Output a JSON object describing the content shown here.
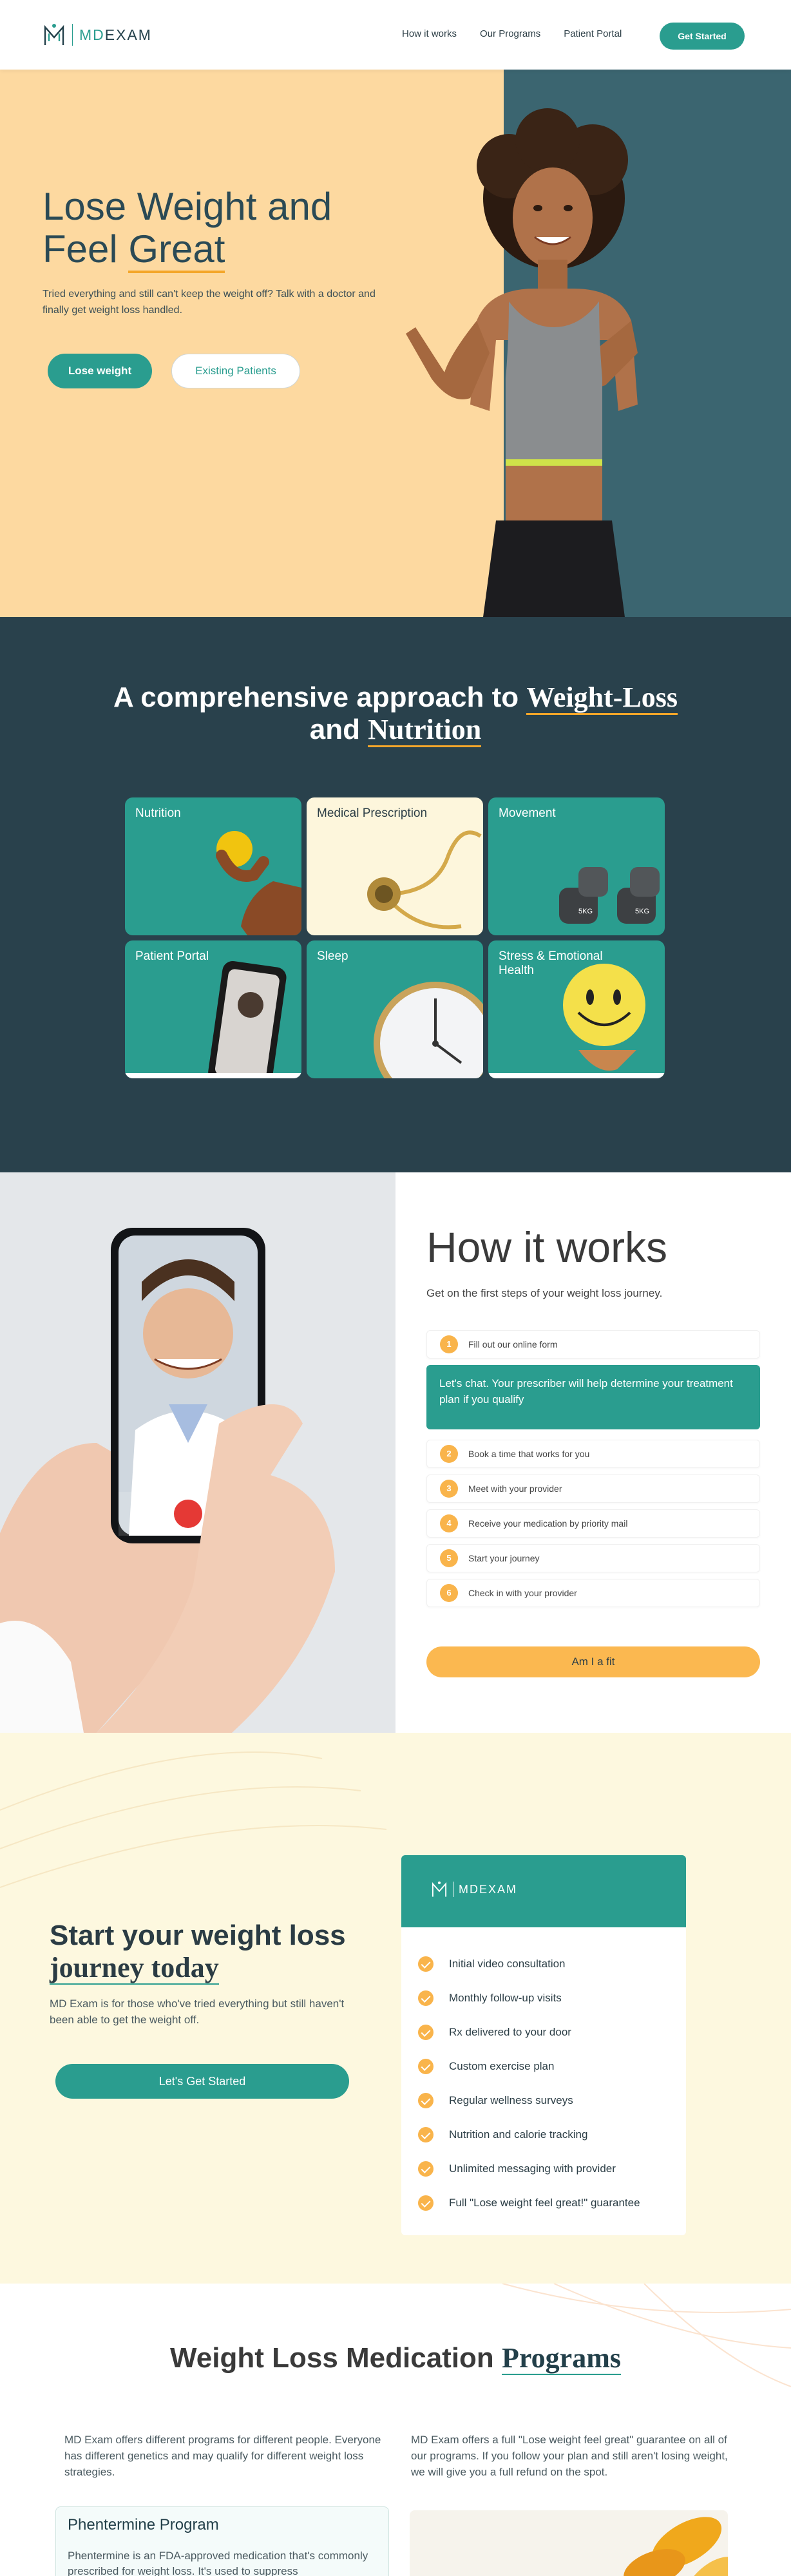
{
  "nav": {
    "logo_m": "MD",
    "logo_rest": "EXAM",
    "links": [
      "How it works",
      "Our Programs",
      "Patient Portal"
    ],
    "cta": "Get Started"
  },
  "hero": {
    "title_line1": "Lose Weight and",
    "title_line2a": "Feel ",
    "title_line2b": "Great",
    "subtitle": "Tried everything and still can't keep the weight off? Talk with a doctor and finally get weight loss handled.",
    "primary_button": "Lose weight",
    "secondary_button": "Existing Patients"
  },
  "approach": {
    "title_a": "A comprehensive approach to ",
    "title_b": "Weight-Loss",
    "title_c": "and ",
    "title_d": "Nutrition",
    "cards": [
      {
        "label": "Nutrition"
      },
      {
        "label": "Medical Prescription"
      },
      {
        "label": "Movement"
      },
      {
        "label": "Patient Portal"
      },
      {
        "label": "Sleep"
      },
      {
        "label": "Stress & Emotional Health"
      }
    ],
    "dumbbell_text": "5KG"
  },
  "how": {
    "title": "How it works",
    "subtitle": "Get on the first steps of your weight loss journey.",
    "steps": [
      {
        "num": "1",
        "text": "Fill out our online form"
      },
      {
        "num": "2",
        "text": "Book a time that works for you"
      },
      {
        "num": "3",
        "text": "Meet with your provider"
      },
      {
        "num": "4",
        "text": "Receive your medication by priority mail"
      },
      {
        "num": "5",
        "text": "Start your journey"
      },
      {
        "num": "6",
        "text": "Check in with your provider"
      }
    ],
    "open_step_text": "Let's chat. Your prescriber will help determine your treatment plan if you qualify",
    "button": "Am I a fit"
  },
  "journey": {
    "title_a": "Start your weight loss",
    "title_b": "journey today",
    "subtitle": "MD Exam is for those who've tried everything but still haven't been able to get the weight off.",
    "button": "Let's Get Started",
    "plan_logo": "MDEXAM",
    "plan_items": [
      "Initial video consultation",
      "Monthly follow-up visits",
      "Rx delivered to your door",
      "Custom exercise plan",
      "Regular wellness surveys",
      "Nutrition and calorie tracking",
      "Unlimited messaging with provider",
      "Full \"Lose weight feel great!\" guarantee"
    ]
  },
  "programs": {
    "title_a": "Weight Loss Medication ",
    "title_b": "Programs",
    "para1": "MD Exam offers different programs for different people. Everyone has different genetics and may qualify for different weight loss strategies.",
    "para2": "MD Exam offers a full \"Lose weight feel great\" guarantee on all of our programs. If you follow your plan and still aren't losing weight, we will give you a full refund on the spot.",
    "card_title": "Phentermine Program",
    "card_text": "Phentermine is an FDA-approved medication that's commonly prescribed for weight loss. It's used to suppress"
  },
  "colors": {
    "teal": "#2a9d8f",
    "dark_slate": "#29414c",
    "peach": "#fdd9a0",
    "amber": "#f9b44b",
    "cream": "#fdf8df"
  }
}
